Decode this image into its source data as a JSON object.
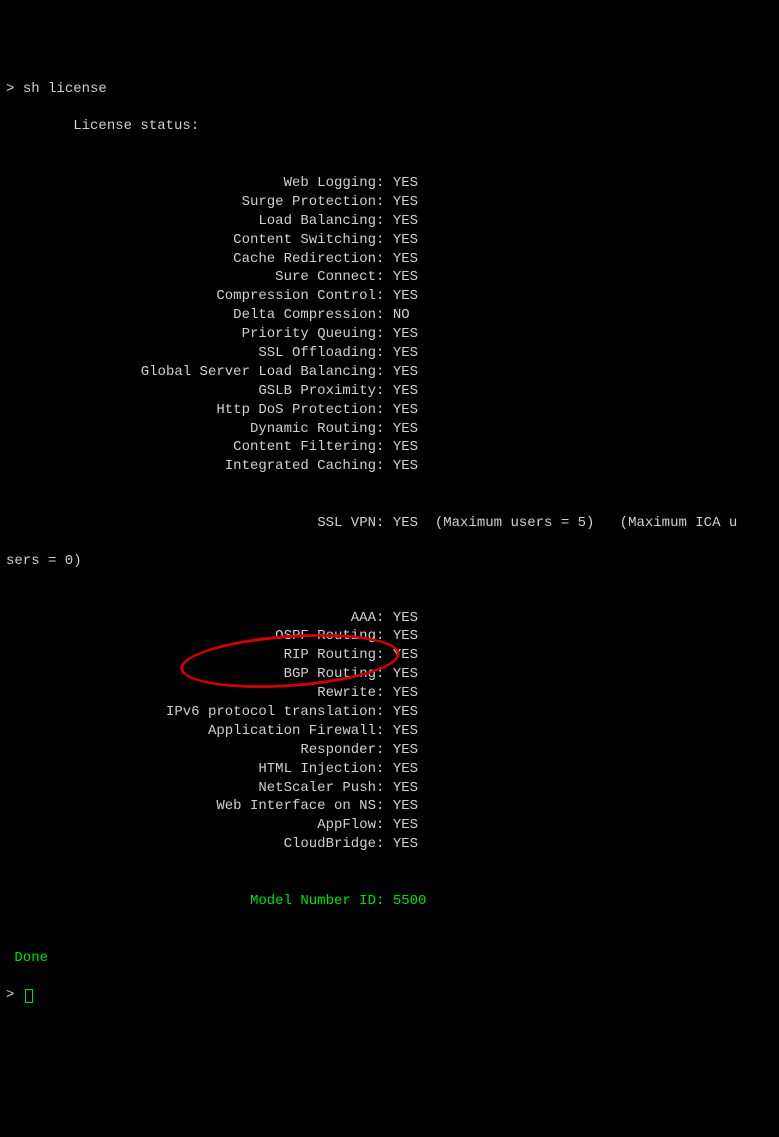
{
  "prompt_symbol": ">",
  "command": "sh license",
  "header_indent": "        ",
  "header": "License status:",
  "features": [
    {
      "label": "Web Logging",
      "value": "YES"
    },
    {
      "label": "Surge Protection",
      "value": "YES"
    },
    {
      "label": "Load Balancing",
      "value": "YES"
    },
    {
      "label": "Content Switching",
      "value": "YES"
    },
    {
      "label": "Cache Redirection",
      "value": "YES"
    },
    {
      "label": "Sure Connect",
      "value": "YES"
    },
    {
      "label": "Compression Control",
      "value": "YES"
    },
    {
      "label": "Delta Compression",
      "value": "NO"
    },
    {
      "label": "Priority Queuing",
      "value": "YES"
    },
    {
      "label": "SSL Offloading",
      "value": "YES"
    },
    {
      "label": "Global Server Load Balancing",
      "value": "YES"
    },
    {
      "label": "GSLB Proximity",
      "value": "YES"
    },
    {
      "label": "Http DoS Protection",
      "value": "YES"
    },
    {
      "label": "Dynamic Routing",
      "value": "YES"
    },
    {
      "label": "Content Filtering",
      "value": "YES"
    },
    {
      "label": "Integrated Caching",
      "value": "YES"
    }
  ],
  "sslvpn_label": "SSL VPN",
  "sslvpn_value": "YES",
  "sslvpn_extra": "  (Maximum users = 5)   (Maximum ICA u",
  "sslvpn_wrap": "sers = 0)",
  "features2": [
    {
      "label": "AAA",
      "value": "YES"
    },
    {
      "label": "OSPF Routing",
      "value": "YES"
    },
    {
      "label": "RIP Routing",
      "value": "YES"
    },
    {
      "label": "BGP Routing",
      "value": "YES"
    },
    {
      "label": "Rewrite",
      "value": "YES"
    },
    {
      "label": "IPv6 protocol translation",
      "value": "YES"
    },
    {
      "label": "Application Firewall",
      "value": "YES"
    },
    {
      "label": "Responder",
      "value": "YES"
    },
    {
      "label": "HTML Injection",
      "value": "YES"
    },
    {
      "label": "NetScaler Push",
      "value": "YES"
    },
    {
      "label": "Web Interface on NS",
      "value": "YES"
    },
    {
      "label": "AppFlow",
      "value": "YES"
    },
    {
      "label": "CloudBridge",
      "value": "YES"
    }
  ],
  "model_label": "Model Number ID",
  "model_value": "5500",
  "done_text": " Done",
  "end_prompt": ">"
}
